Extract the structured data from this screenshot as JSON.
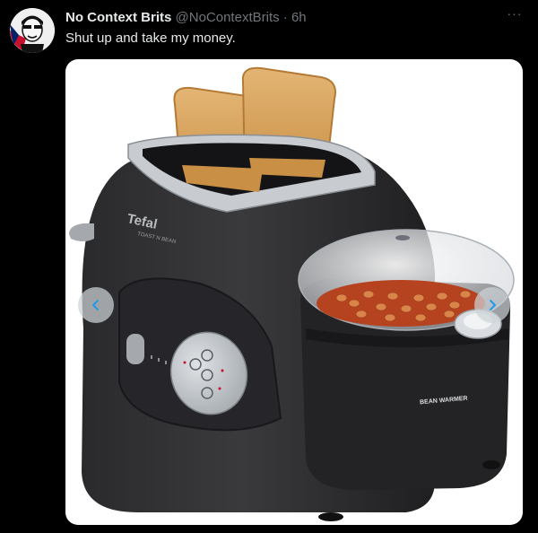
{
  "tweet": {
    "display_name": "No Context Brits",
    "handle": "@NoContextBrits",
    "separator": "·",
    "time": "6h",
    "text": "Shut up and take my money.",
    "more_label": "···"
  },
  "media": {
    "brand_text": "Tefal",
    "model_text": "TOAST N BEAN",
    "bean_warmer_text": "BEAN WARMER"
  },
  "colors": {
    "background": "#000000",
    "text_primary": "#e7e9ea",
    "text_secondary": "#71767b",
    "accent": "#1d9bf0"
  },
  "icons": {
    "prev": "chevron-left-icon",
    "next": "chevron-right-icon",
    "more": "more-dots-icon"
  }
}
